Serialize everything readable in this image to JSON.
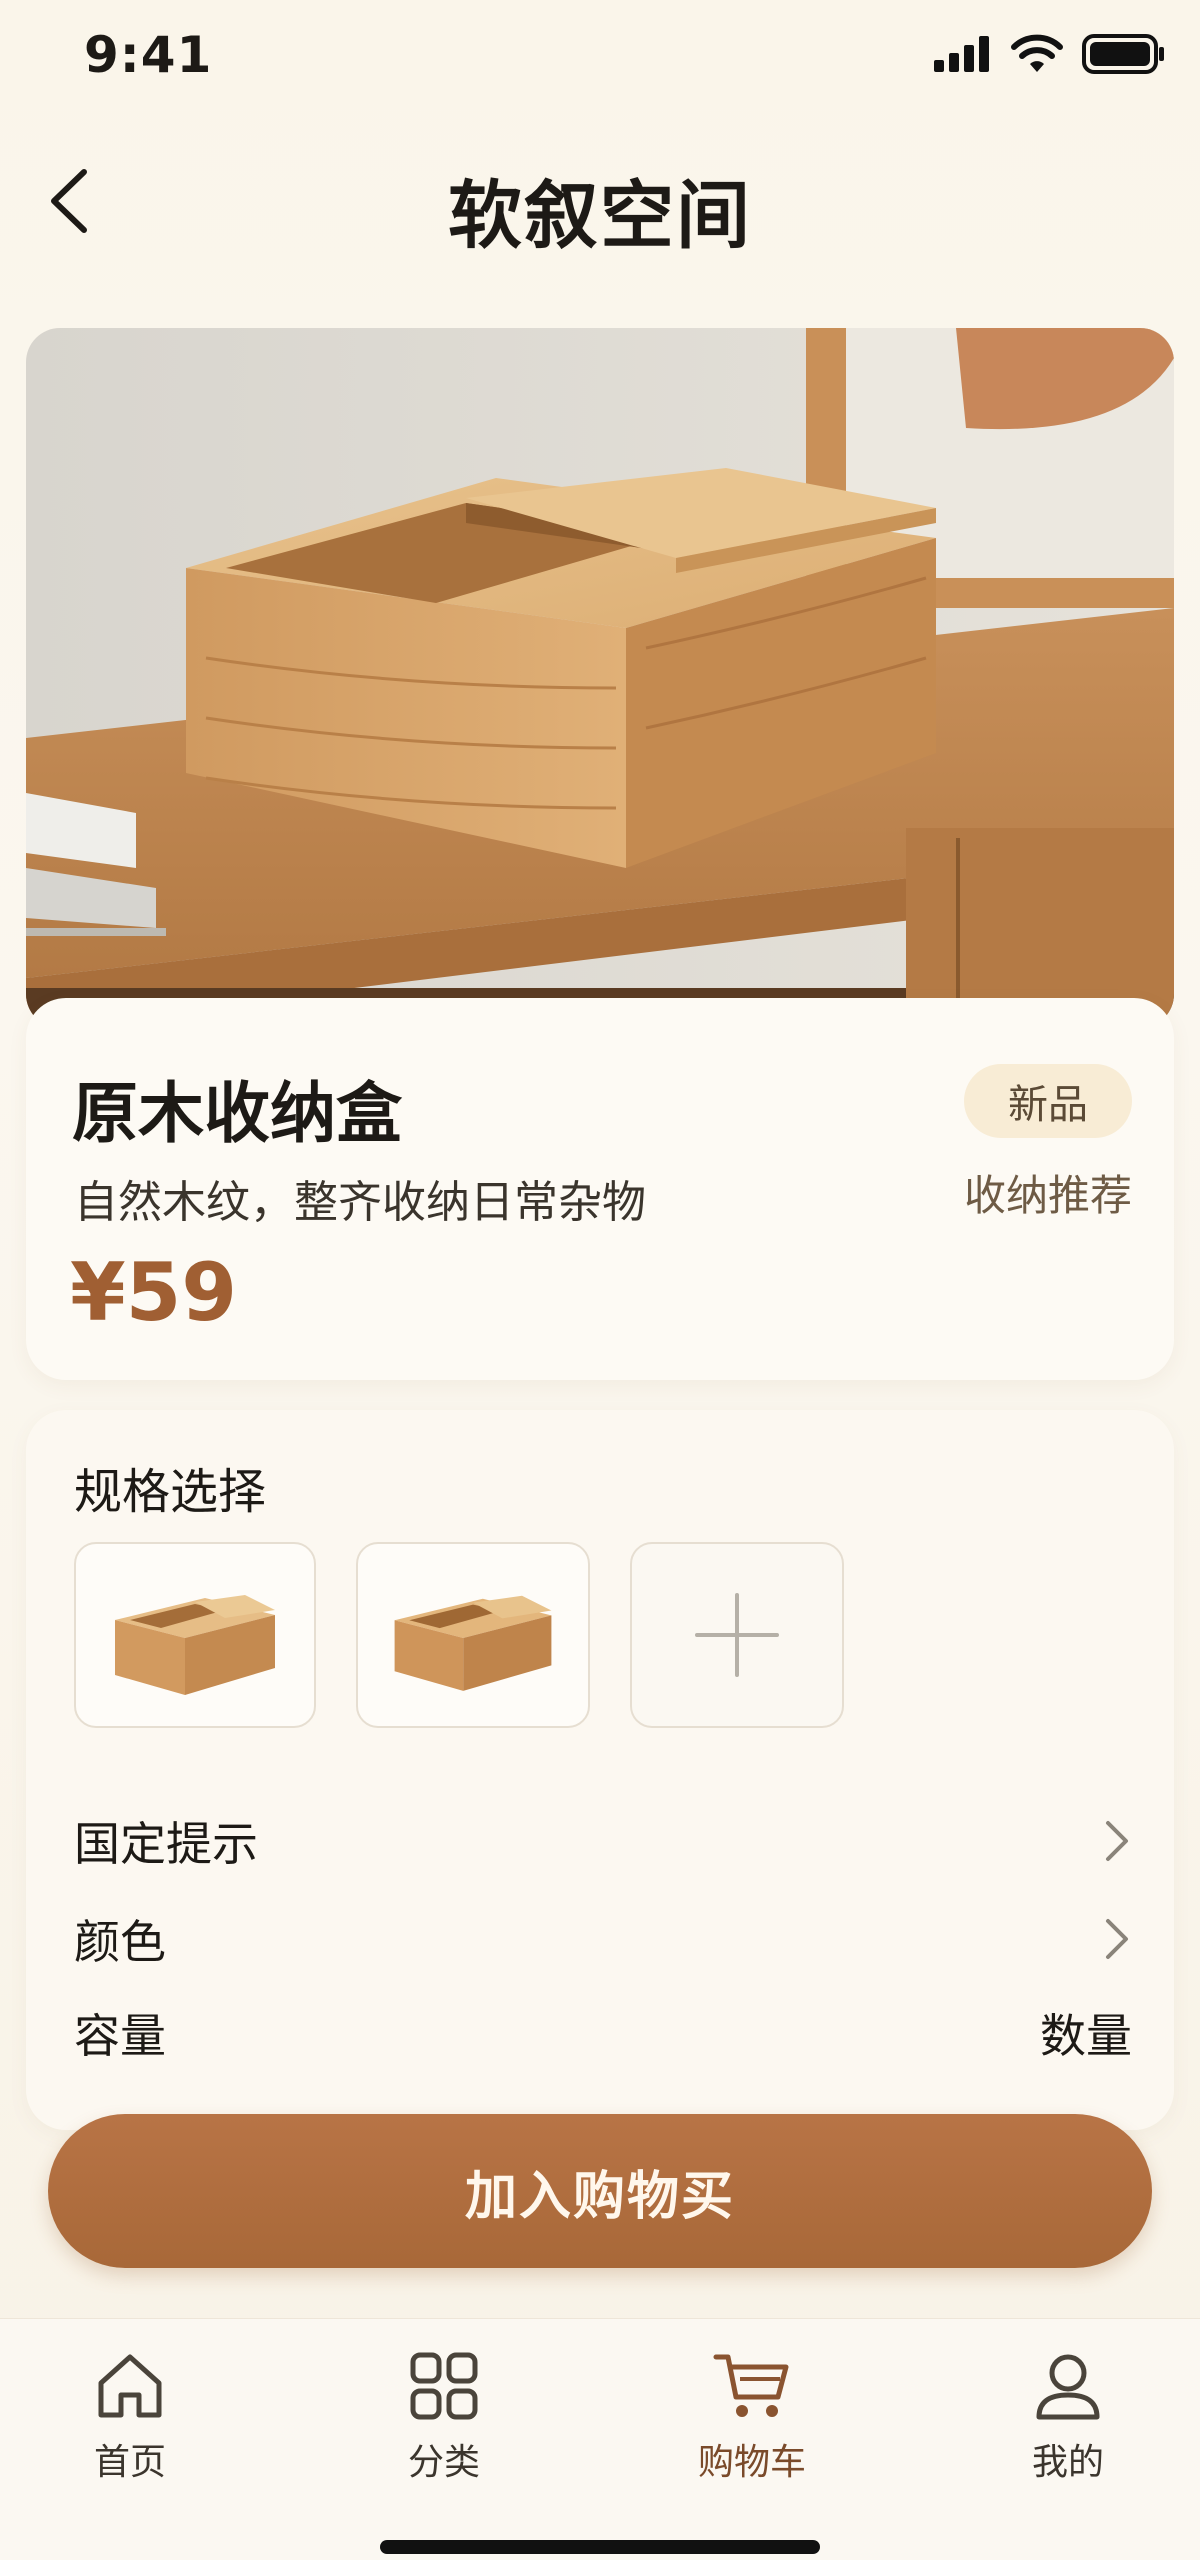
{
  "status_bar": {
    "time": "9:41"
  },
  "header": {
    "title": "软叙空间"
  },
  "product": {
    "name": "原木收纳盒",
    "description": "自然木纹，整齐收纳日常杂物",
    "price": "¥59",
    "badge": "新品",
    "recommend": "收纳推荐"
  },
  "spec": {
    "title": "规格选择",
    "rows": [
      {
        "label": "国定提示",
        "icon": "chevron-right-icon"
      },
      {
        "label": "颜色",
        "icon": "chevron-right-icon"
      },
      {
        "label": "容量",
        "value": "数量"
      }
    ]
  },
  "cta": {
    "label": "加入购物买"
  },
  "tab_bar": {
    "items": [
      {
        "label": "首页",
        "icon": "home-icon"
      },
      {
        "label": "分类",
        "icon": "grid-icon"
      },
      {
        "label": "购物车",
        "icon": "cart-icon",
        "active": true
      },
      {
        "label": "我的",
        "icon": "user-icon"
      }
    ]
  },
  "colors": {
    "accent": "#a86838",
    "price": "#a05f33",
    "background": "#f8f3e9"
  }
}
